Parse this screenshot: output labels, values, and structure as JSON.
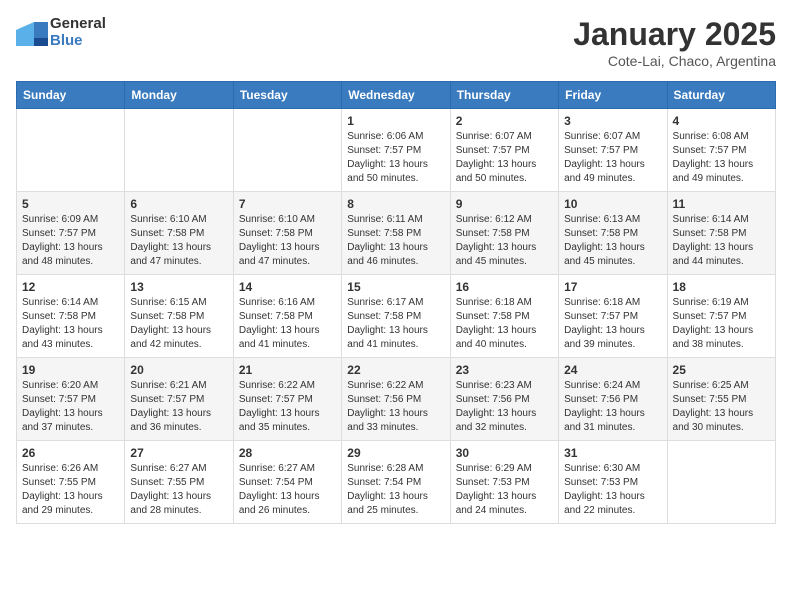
{
  "header": {
    "logo_general": "General",
    "logo_blue": "Blue",
    "title": "January 2025",
    "subtitle": "Cote-Lai, Chaco, Argentina"
  },
  "columns": [
    "Sunday",
    "Monday",
    "Tuesday",
    "Wednesday",
    "Thursday",
    "Friday",
    "Saturday"
  ],
  "weeks": [
    [
      {
        "day": "",
        "info": ""
      },
      {
        "day": "",
        "info": ""
      },
      {
        "day": "",
        "info": ""
      },
      {
        "day": "1",
        "info": "Sunrise: 6:06 AM\nSunset: 7:57 PM\nDaylight: 13 hours and 50 minutes."
      },
      {
        "day": "2",
        "info": "Sunrise: 6:07 AM\nSunset: 7:57 PM\nDaylight: 13 hours and 50 minutes."
      },
      {
        "day": "3",
        "info": "Sunrise: 6:07 AM\nSunset: 7:57 PM\nDaylight: 13 hours and 49 minutes."
      },
      {
        "day": "4",
        "info": "Sunrise: 6:08 AM\nSunset: 7:57 PM\nDaylight: 13 hours and 49 minutes."
      }
    ],
    [
      {
        "day": "5",
        "info": "Sunrise: 6:09 AM\nSunset: 7:57 PM\nDaylight: 13 hours and 48 minutes."
      },
      {
        "day": "6",
        "info": "Sunrise: 6:10 AM\nSunset: 7:58 PM\nDaylight: 13 hours and 47 minutes."
      },
      {
        "day": "7",
        "info": "Sunrise: 6:10 AM\nSunset: 7:58 PM\nDaylight: 13 hours and 47 minutes."
      },
      {
        "day": "8",
        "info": "Sunrise: 6:11 AM\nSunset: 7:58 PM\nDaylight: 13 hours and 46 minutes."
      },
      {
        "day": "9",
        "info": "Sunrise: 6:12 AM\nSunset: 7:58 PM\nDaylight: 13 hours and 45 minutes."
      },
      {
        "day": "10",
        "info": "Sunrise: 6:13 AM\nSunset: 7:58 PM\nDaylight: 13 hours and 45 minutes."
      },
      {
        "day": "11",
        "info": "Sunrise: 6:14 AM\nSunset: 7:58 PM\nDaylight: 13 hours and 44 minutes."
      }
    ],
    [
      {
        "day": "12",
        "info": "Sunrise: 6:14 AM\nSunset: 7:58 PM\nDaylight: 13 hours and 43 minutes."
      },
      {
        "day": "13",
        "info": "Sunrise: 6:15 AM\nSunset: 7:58 PM\nDaylight: 13 hours and 42 minutes."
      },
      {
        "day": "14",
        "info": "Sunrise: 6:16 AM\nSunset: 7:58 PM\nDaylight: 13 hours and 41 minutes."
      },
      {
        "day": "15",
        "info": "Sunrise: 6:17 AM\nSunset: 7:58 PM\nDaylight: 13 hours and 41 minutes."
      },
      {
        "day": "16",
        "info": "Sunrise: 6:18 AM\nSunset: 7:58 PM\nDaylight: 13 hours and 40 minutes."
      },
      {
        "day": "17",
        "info": "Sunrise: 6:18 AM\nSunset: 7:57 PM\nDaylight: 13 hours and 39 minutes."
      },
      {
        "day": "18",
        "info": "Sunrise: 6:19 AM\nSunset: 7:57 PM\nDaylight: 13 hours and 38 minutes."
      }
    ],
    [
      {
        "day": "19",
        "info": "Sunrise: 6:20 AM\nSunset: 7:57 PM\nDaylight: 13 hours and 37 minutes."
      },
      {
        "day": "20",
        "info": "Sunrise: 6:21 AM\nSunset: 7:57 PM\nDaylight: 13 hours and 36 minutes."
      },
      {
        "day": "21",
        "info": "Sunrise: 6:22 AM\nSunset: 7:57 PM\nDaylight: 13 hours and 35 minutes."
      },
      {
        "day": "22",
        "info": "Sunrise: 6:22 AM\nSunset: 7:56 PM\nDaylight: 13 hours and 33 minutes."
      },
      {
        "day": "23",
        "info": "Sunrise: 6:23 AM\nSunset: 7:56 PM\nDaylight: 13 hours and 32 minutes."
      },
      {
        "day": "24",
        "info": "Sunrise: 6:24 AM\nSunset: 7:56 PM\nDaylight: 13 hours and 31 minutes."
      },
      {
        "day": "25",
        "info": "Sunrise: 6:25 AM\nSunset: 7:55 PM\nDaylight: 13 hours and 30 minutes."
      }
    ],
    [
      {
        "day": "26",
        "info": "Sunrise: 6:26 AM\nSunset: 7:55 PM\nDaylight: 13 hours and 29 minutes."
      },
      {
        "day": "27",
        "info": "Sunrise: 6:27 AM\nSunset: 7:55 PM\nDaylight: 13 hours and 28 minutes."
      },
      {
        "day": "28",
        "info": "Sunrise: 6:27 AM\nSunset: 7:54 PM\nDaylight: 13 hours and 26 minutes."
      },
      {
        "day": "29",
        "info": "Sunrise: 6:28 AM\nSunset: 7:54 PM\nDaylight: 13 hours and 25 minutes."
      },
      {
        "day": "30",
        "info": "Sunrise: 6:29 AM\nSunset: 7:53 PM\nDaylight: 13 hours and 24 minutes."
      },
      {
        "day": "31",
        "info": "Sunrise: 6:30 AM\nSunset: 7:53 PM\nDaylight: 13 hours and 22 minutes."
      },
      {
        "day": "",
        "info": ""
      }
    ]
  ]
}
